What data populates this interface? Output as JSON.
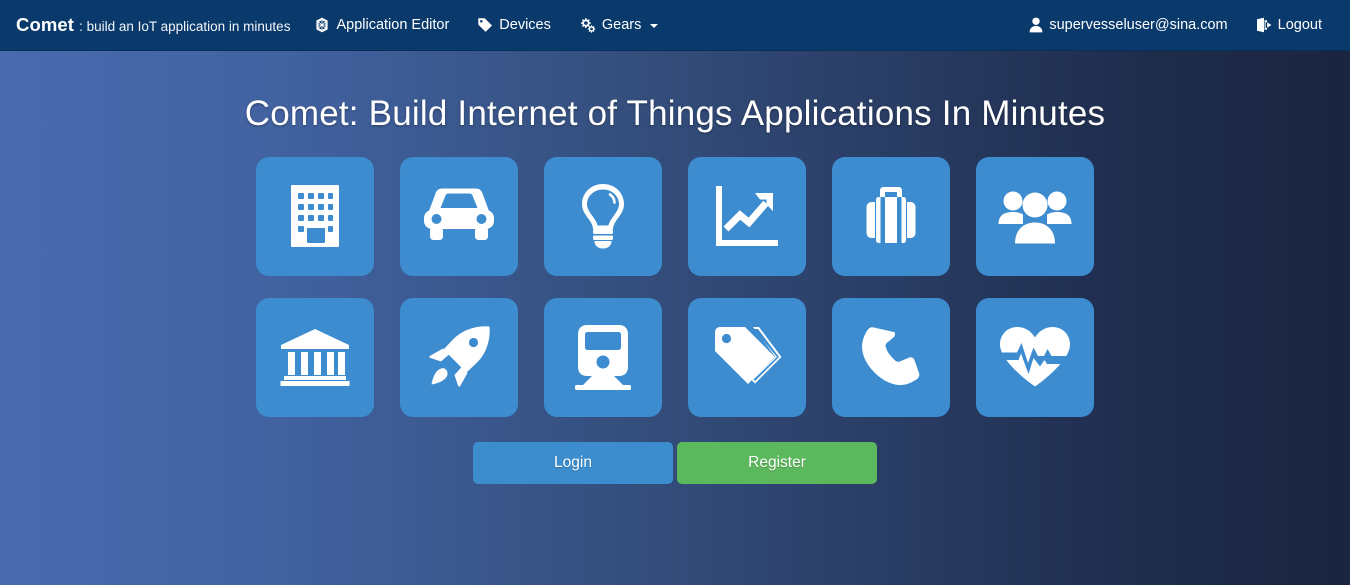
{
  "navbar": {
    "brand_name": "Comet",
    "brand_tagline": ": build an IoT application in minutes",
    "items": [
      {
        "label": "Application Editor",
        "icon": "network-globe-icon"
      },
      {
        "label": "Devices",
        "icon": "tag-icon"
      },
      {
        "label": "Gears",
        "icon": "cogs-icon",
        "caret": true
      }
    ],
    "user": {
      "label": "supervesseluser@sina.com",
      "icon": "user-icon"
    },
    "logout": {
      "label": "Logout",
      "icon": "sign-out-icon"
    },
    "background_color": "#0a3a6b"
  },
  "hero": {
    "title": "Comet: Build Internet of Things Applications In Minutes",
    "background_gradient_from": "#4a6ab0",
    "background_gradient_to": "#1a2540"
  },
  "tiles": {
    "color": "#3d8cd0",
    "items": [
      {
        "icon": "building-icon"
      },
      {
        "icon": "car-icon"
      },
      {
        "icon": "lightbulb-icon"
      },
      {
        "icon": "chart-line-icon"
      },
      {
        "icon": "suitcase-icon"
      },
      {
        "icon": "users-group-icon"
      },
      {
        "icon": "bank-icon"
      },
      {
        "icon": "rocket-icon"
      },
      {
        "icon": "train-icon"
      },
      {
        "icon": "tags-icon"
      },
      {
        "icon": "phone-icon"
      },
      {
        "icon": "heartbeat-icon"
      }
    ]
  },
  "actions": {
    "login_label": "Login",
    "login_color": "#3c8dcd",
    "register_label": "Register",
    "register_color": "#5cb85c"
  }
}
